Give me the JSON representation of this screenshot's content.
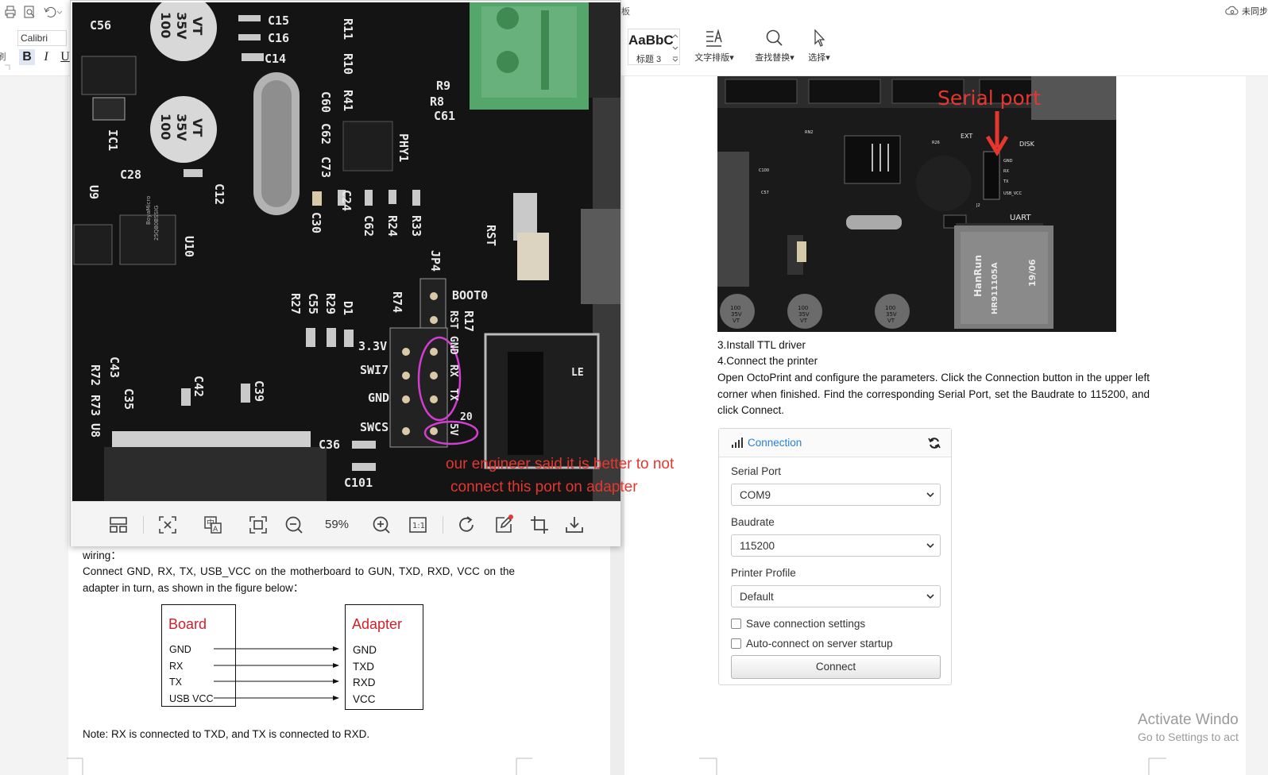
{
  "toolbar": {
    "font_name": "Calibri",
    "bold_label": "B",
    "italic_label": "I",
    "underline_label": "U",
    "left_cut_label": "刷",
    "top_cut_label": "板",
    "style_preview": "AaBbC",
    "style_name": "标题 3",
    "text_layout_label": "文字排版",
    "find_replace_label": "查找替换",
    "select_label": "选择",
    "sync_status": "未同步"
  },
  "viewer": {
    "zoom": "59%",
    "tools": [
      "layout-icon",
      "fit-icon",
      "translate-icon",
      "fullscreen-icon",
      "zoom-out-icon",
      "zoom-in-icon",
      "actual-size-icon",
      "rotate-icon",
      "edit-icon",
      "crop-icon",
      "download-icon"
    ]
  },
  "photo_left": {
    "silk": {
      "c56": "C56",
      "c15": "C15",
      "c16": "C16",
      "c14": "C14",
      "r11": "R11",
      "r10": "R10",
      "r41": "R41",
      "r9": "R9",
      "r8": "R8",
      "c61": "C61",
      "c60": "C60",
      "c62a": "C62",
      "c73": "C73",
      "phy1": "PHY1",
      "c28": "C28",
      "u9": "U9",
      "c12": "C12",
      "c24": "C24",
      "c30": "C30",
      "c62b": "C62",
      "r24": "R24",
      "r33": "R33",
      "rst": "RST",
      "jp4": "JP4",
      "boot0": "BOOT0",
      "r17": "R17",
      "r74": "R74",
      "c55": "C55",
      "r29": "R29",
      "d1": "D1",
      "r27": "R27",
      "v33": "3.3V",
      "swi": "SWI7",
      "gnd": "GND",
      "swcs": "SWCS",
      "c36": "C36",
      "c101": "C101",
      "c43": "C43",
      "c35": "C35",
      "c42": "C42",
      "c39": "C39",
      "r72": "R72",
      "r73": "R73",
      "u8": "U8",
      "u10": "U10",
      "ic1": "IC1",
      "cap_a_1": "100",
      "cap_a_2": "35V",
      "cap_a_3": "VT",
      "cap_b_1": "100",
      "cap_b_2": "35V",
      "cap_b_3": "VT",
      "chip_u9": "BoyaMicro",
      "chip_u9b": "25Q80BSSIG",
      "rst_pin": "RST",
      "gnd_pin": "GND",
      "rx_pin": "RX",
      "tx_pin": "TX",
      "v5_pin": "5V",
      "n20": "20",
      "le": "LE"
    }
  },
  "red_note": {
    "line1": "our engineer said it  is better to not",
    "line2": "connect this port on adapter"
  },
  "left_doc": {
    "wiring_label": "wiring：",
    "wiring_text": "Connect GND, RX, TX, USB_VCC on the motherboard to GUN, TXD, RXD, VCC on the adapter in turn, as shown in the figure below：",
    "note": "Note: RX is connected to TXD, and TX is connected to RXD."
  },
  "diagram": {
    "board_title": "Board",
    "adapter_title": "Adapter",
    "board_pins": [
      "GND",
      "RX",
      "TX",
      "USB  VCC"
    ],
    "adapter_pins": [
      "GND",
      "TXD",
      "RXD",
      "VCC"
    ]
  },
  "photo_right": {
    "annotation": "Serial port",
    "silk": {
      "disk": "DISK",
      "gnd": "GND",
      "rx": "RX",
      "tx": "TX",
      "usb_vcc": "USB_VCC",
      "uart": "UART",
      "ext": "EXT",
      "j2": "J2",
      "hanrun": "HanRun",
      "part": "HR911105A",
      "date": "19/06",
      "cap1_a": "100",
      "cap1_b": "35V",
      "cap1_c": "VT",
      "cap2_a": "100",
      "cap2_b": "35V",
      "cap2_c": "VT",
      "cap3_a": "100",
      "cap3_b": "35V",
      "cap3_c": "VT",
      "c100": "C100",
      "c57": "C57",
      "rn2": "RN2",
      "r26": "R26"
    }
  },
  "right_doc": {
    "step3": "3.Install TTL driver",
    "step4": "4.Connect the printer",
    "instructions": "Open OctoPrint and configure the parameters. Click the Connection button in the upper left corner when finished. Find the corresponding Serial Port, set the Baudrate to 115200, and click Connect."
  },
  "connection_panel": {
    "title": "Connection",
    "serial_port_label": "Serial Port",
    "serial_port_value": "COM9",
    "baudrate_label": "Baudrate",
    "baudrate_value": "115200",
    "profile_label": "Printer Profile",
    "profile_value": "Default",
    "save_settings_label": "Save connection settings",
    "autoconnect_label": "Auto-connect on server startup",
    "connect_button": "Connect"
  },
  "activation": {
    "line1": "Activate Windo",
    "line2": "Go to Settings to act"
  },
  "colors": {
    "link_blue": "#2a7fd4",
    "annotation_red": "#e5372f",
    "diagram_red": "#d0212b",
    "highlight_magenta": "#d23fd0",
    "pcb_black": "#141414",
    "silk_white": "#e8e8e8"
  }
}
